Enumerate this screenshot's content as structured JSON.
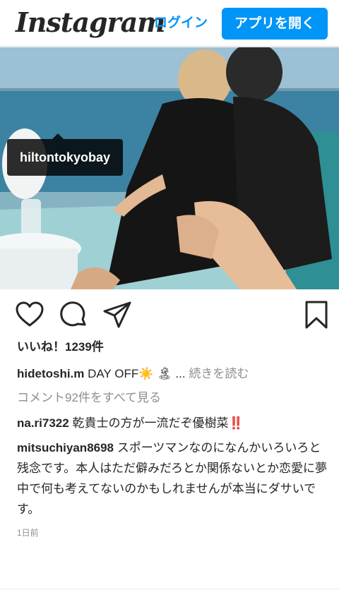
{
  "header": {
    "logo": "Instagram",
    "login_label": "ログイン",
    "open_app_label": "アプリを開く"
  },
  "photo": {
    "tagged_account": "hiltontokyobay"
  },
  "post": {
    "likes": "いいね！1239件",
    "caption": {
      "username": "hidetoshi.m",
      "text": "DAY OFF☀️ 🏝 ...",
      "more_label": "続きを読む"
    },
    "view_all_comments": "コメント92件をすべて見る",
    "comments": [
      {
        "username": "na.ri7322",
        "text": "乾貴士の方が一流だぞ優樹菜",
        "emoji": "‼️"
      },
      {
        "username": "mitsuchiyan8698",
        "text": "スポーツマンなのになんかいろいろと残念です。本人はただ僻みだろとか関係ないとか恋愛に夢中で何も考えてないのかもしれませんが本当にダサいです。"
      }
    ],
    "time_ago": "1日前"
  },
  "icons": {
    "like": "heart-icon",
    "comment": "comment-icon",
    "share": "share-icon",
    "save": "bookmark-icon",
    "user_tag": "user-icon"
  },
  "colors": {
    "accent": "#0095f6",
    "text": "#262626",
    "muted": "#8e8e8e"
  }
}
